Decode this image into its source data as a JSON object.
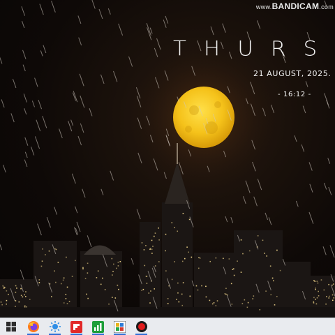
{
  "watermark": {
    "prefix": "www.",
    "brand": "BANDICAM",
    "suffix": ".com"
  },
  "widget": {
    "day": "THURSDAY",
    "date": "21 AUGUST, 2025.",
    "time": "- 16:12 -"
  },
  "colors": {
    "moon": "#f5c21a",
    "taskbar": "#e9ebef",
    "text": "#f2f2f2",
    "recorder": "#e01b1b"
  },
  "taskbar": {
    "items": [
      {
        "icon": "windows-start-icon",
        "active": false
      },
      {
        "icon": "firefox-icon",
        "active": true
      },
      {
        "icon": "weather-app-icon",
        "active": true
      },
      {
        "icon": "flipboard-icon",
        "active": true
      },
      {
        "icon": "chart-app-icon",
        "active": true
      },
      {
        "icon": "photos-app-icon",
        "active": true
      },
      {
        "icon": "bandicam-record-icon",
        "active": true
      }
    ]
  }
}
